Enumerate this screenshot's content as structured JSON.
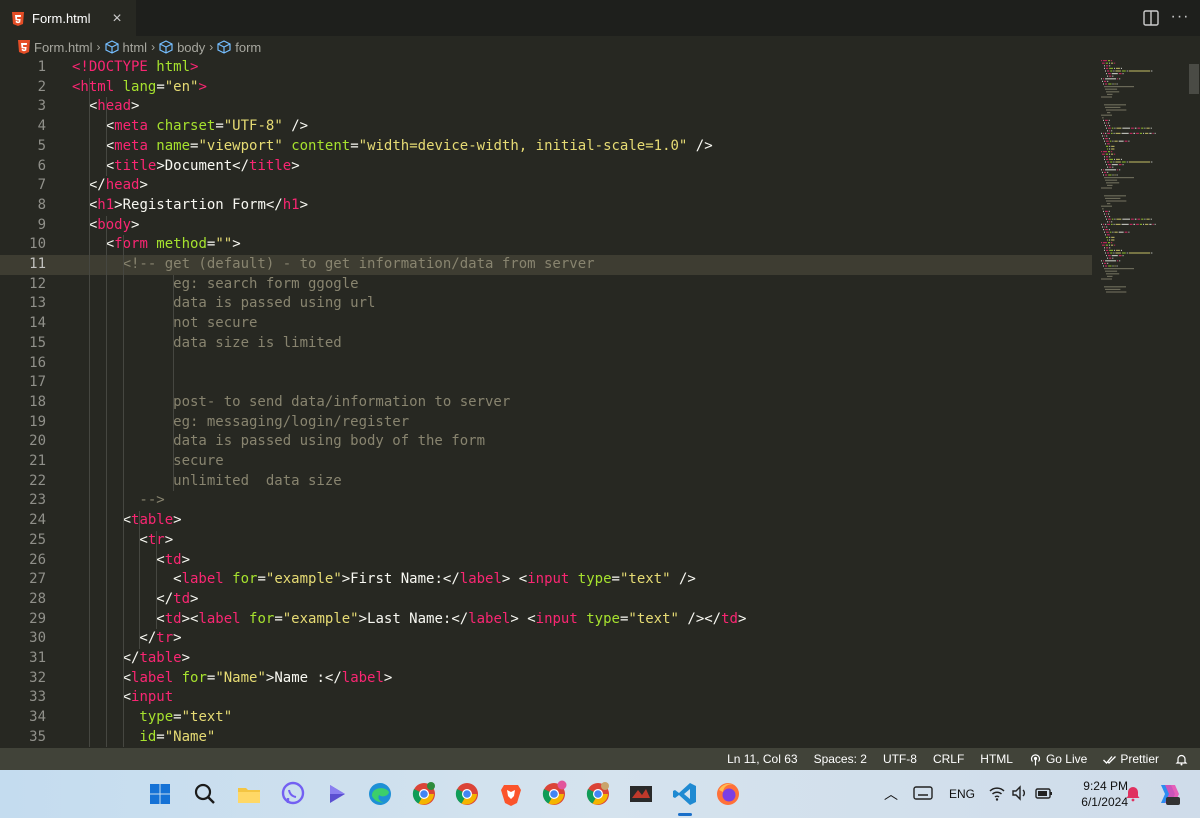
{
  "tab": {
    "filename": "Form.html"
  },
  "breadcrumb": {
    "file": "Form.html",
    "items": [
      "html",
      "body",
      "form"
    ]
  },
  "editor": {
    "current_line": 11,
    "lines": [
      [
        [
          "t",
          "<!"
        ],
        [
          "t",
          "DOCTYPE"
        ],
        [
          "a",
          " html"
        ],
        [
          "t",
          ">"
        ]
      ],
      [
        [
          "t",
          "<html"
        ],
        [
          "a",
          " lang"
        ],
        [
          "x",
          "="
        ],
        [
          "s",
          "\"en\""
        ],
        [
          "t",
          ">"
        ]
      ],
      [
        [
          "x",
          "  "
        ],
        [
          "x",
          "<"
        ],
        [
          "t",
          "head"
        ],
        [
          "x",
          ">"
        ]
      ],
      [
        [
          "x",
          "    <"
        ],
        [
          "t",
          "meta"
        ],
        [
          "a",
          " charset"
        ],
        [
          "x",
          "="
        ],
        [
          "s",
          "\"UTF-8\""
        ],
        [
          "x",
          " />"
        ]
      ],
      [
        [
          "x",
          "    <"
        ],
        [
          "t",
          "meta"
        ],
        [
          "a",
          " name"
        ],
        [
          "x",
          "="
        ],
        [
          "s",
          "\"viewport\""
        ],
        [
          "a",
          " content"
        ],
        [
          "x",
          "="
        ],
        [
          "s",
          "\"width=device-width, initial-scale=1.0\""
        ],
        [
          "x",
          " />"
        ]
      ],
      [
        [
          "x",
          "    <"
        ],
        [
          "t",
          "title"
        ],
        [
          "x",
          ">Document</"
        ],
        [
          "t",
          "title"
        ],
        [
          "x",
          ">"
        ]
      ],
      [
        [
          "x",
          "  </"
        ],
        [
          "t",
          "head"
        ],
        [
          "x",
          ">"
        ]
      ],
      [
        [
          "x",
          "  <"
        ],
        [
          "t",
          "h1"
        ],
        [
          "x",
          ">Registartion Form</"
        ],
        [
          "t",
          "h1"
        ],
        [
          "x",
          ">"
        ]
      ],
      [
        [
          "x",
          "  <"
        ],
        [
          "t",
          "body"
        ],
        [
          "x",
          ">"
        ]
      ],
      [
        [
          "x",
          "    <"
        ],
        [
          "t",
          "form"
        ],
        [
          "a",
          " method"
        ],
        [
          "x",
          "="
        ],
        [
          "s",
          "\"\""
        ],
        [
          "x",
          ">"
        ]
      ],
      [
        [
          "c",
          "      <!-- get (default) - to get information/data from server"
        ]
      ],
      [
        [
          "c",
          "            eg: search form ggogle"
        ]
      ],
      [
        [
          "c",
          "            data is passed using url"
        ]
      ],
      [
        [
          "c",
          "            not secure"
        ]
      ],
      [
        [
          "c",
          "            data size is limited"
        ]
      ],
      [
        [
          "c",
          ""
        ]
      ],
      [
        [
          "c",
          ""
        ]
      ],
      [
        [
          "c",
          "            post- to send data/information to server"
        ]
      ],
      [
        [
          "c",
          "            eg: messaging/login/register"
        ]
      ],
      [
        [
          "c",
          "            data is passed using body of the form"
        ]
      ],
      [
        [
          "c",
          "            secure"
        ]
      ],
      [
        [
          "c",
          "            unlimited  data size"
        ]
      ],
      [
        [
          "c",
          "        -->"
        ]
      ],
      [
        [
          "x",
          "      <"
        ],
        [
          "t",
          "table"
        ],
        [
          "x",
          ">"
        ]
      ],
      [
        [
          "x",
          "        <"
        ],
        [
          "t",
          "tr"
        ],
        [
          "x",
          ">"
        ]
      ],
      [
        [
          "x",
          "          <"
        ],
        [
          "t",
          "td"
        ],
        [
          "x",
          ">"
        ]
      ],
      [
        [
          "x",
          "            <"
        ],
        [
          "t",
          "label"
        ],
        [
          "a",
          " for"
        ],
        [
          "x",
          "="
        ],
        [
          "s",
          "\"example\""
        ],
        [
          "x",
          ">First Name:</"
        ],
        [
          "t",
          "label"
        ],
        [
          "x",
          "> <"
        ],
        [
          "t",
          "input"
        ],
        [
          "a",
          " type"
        ],
        [
          "x",
          "="
        ],
        [
          "s",
          "\"text\""
        ],
        [
          "x",
          " />"
        ]
      ],
      [
        [
          "x",
          "          </"
        ],
        [
          "t",
          "td"
        ],
        [
          "x",
          ">"
        ]
      ],
      [
        [
          "x",
          "          <"
        ],
        [
          "t",
          "td"
        ],
        [
          "x",
          "><"
        ],
        [
          "t",
          "label"
        ],
        [
          "a",
          " for"
        ],
        [
          "x",
          "="
        ],
        [
          "s",
          "\"example\""
        ],
        [
          "x",
          ">Last Name:</"
        ],
        [
          "t",
          "label"
        ],
        [
          "x",
          "> <"
        ],
        [
          "t",
          "input"
        ],
        [
          "a",
          " type"
        ],
        [
          "x",
          "="
        ],
        [
          "s",
          "\"text\""
        ],
        [
          "x",
          " /></"
        ],
        [
          "t",
          "td"
        ],
        [
          "x",
          ">"
        ]
      ],
      [
        [
          "x",
          "        </"
        ],
        [
          "t",
          "tr"
        ],
        [
          "x",
          ">"
        ]
      ],
      [
        [
          "x",
          "      </"
        ],
        [
          "t",
          "table"
        ],
        [
          "x",
          ">"
        ]
      ],
      [
        [
          "x",
          "      <"
        ],
        [
          "t",
          "label"
        ],
        [
          "a",
          " for"
        ],
        [
          "x",
          "="
        ],
        [
          "s",
          "\"Name\""
        ],
        [
          "x",
          ">Name :</"
        ],
        [
          "t",
          "label"
        ],
        [
          "x",
          ">"
        ]
      ],
      [
        [
          "x",
          "      <"
        ],
        [
          "t",
          "input"
        ]
      ],
      [
        [
          "a",
          "        type"
        ],
        [
          "x",
          "="
        ],
        [
          "s",
          "\"text\""
        ]
      ],
      [
        [
          "a",
          "        id"
        ],
        [
          "x",
          "="
        ],
        [
          "s",
          "\"Name\""
        ]
      ]
    ]
  },
  "statusbar": {
    "position": "Ln 11, Col 63",
    "spaces": "Spaces: 2",
    "encoding": "UTF-8",
    "eol": "CRLF",
    "language": "HTML",
    "golive": "Go Live",
    "prettier": "Prettier"
  },
  "taskbar": {
    "language": "ENG",
    "time": "9:24 PM",
    "date": "6/1/2024"
  },
  "colors": {
    "tag": "#f92672",
    "attribute": "#a6e22e",
    "string": "#e6db74",
    "comment": "#88846f",
    "text": "#f8f8f2",
    "editor_bg": "#272822"
  }
}
